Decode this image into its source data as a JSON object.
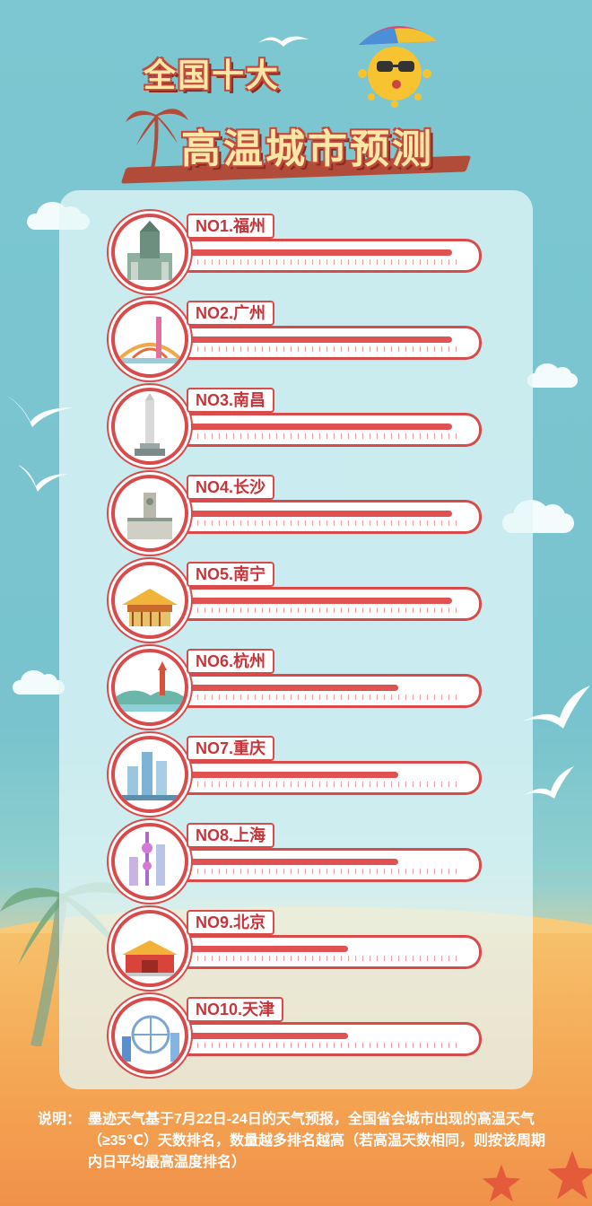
{
  "title": {
    "line1": "全国十大",
    "line2": "高温城市预测"
  },
  "ranking": [
    {
      "label": "NO1.福州",
      "level": 0.92,
      "icon": "fuzhou-landmark-icon"
    },
    {
      "label": "NO2.广州",
      "level": 0.92,
      "icon": "guangzhou-landmark-icon"
    },
    {
      "label": "NO3.南昌",
      "level": 0.92,
      "icon": "nanchang-landmark-icon"
    },
    {
      "label": "NO4.长沙",
      "level": 0.92,
      "icon": "changsha-landmark-icon"
    },
    {
      "label": "NO5.南宁",
      "level": 0.92,
      "icon": "nanning-landmark-icon"
    },
    {
      "label": "NO6.杭州",
      "level": 0.74,
      "icon": "hangzhou-landmark-icon"
    },
    {
      "label": "NO7.重庆",
      "level": 0.74,
      "icon": "chongqing-landmark-icon"
    },
    {
      "label": "NO8.上海",
      "level": 0.74,
      "icon": "shanghai-landmark-icon"
    },
    {
      "label": "NO9.北京",
      "level": 0.57,
      "icon": "beijing-landmark-icon"
    },
    {
      "label": "NO10.天津",
      "level": 0.57,
      "icon": "tianjin-landmark-icon"
    }
  ],
  "note": {
    "key": "说明：",
    "text": "墨迹天气基于7月22日-24日的天气预报，全国省会城市出现的高温天气（≥35℃）天数排名，数量越多排名越高（若高温天数相同，则按该周期内日平均最高温度排名）"
  },
  "colors": {
    "accent": "#d94b4b",
    "fill": "#e05252",
    "title_text": "#fbe7a6"
  }
}
